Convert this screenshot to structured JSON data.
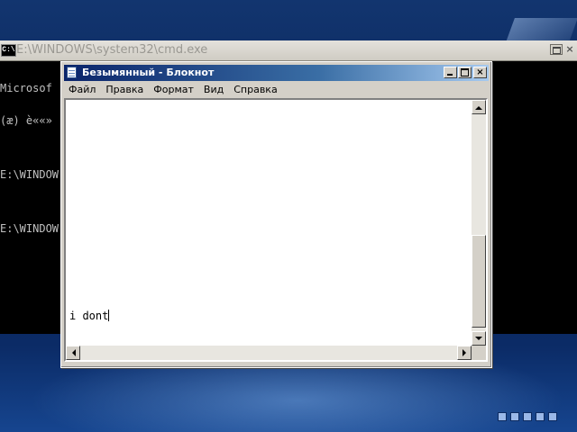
{
  "cmd_window": {
    "icon_label": "C:\\",
    "title": "E:\\WINDOWS\\system32\\cmd.exe",
    "close_label": "×",
    "lines": [
      "Microsof",
      "(æ) è««»",
      "",
      "E:\\WINDOW",
      "",
      "E:\\WINDOW"
    ]
  },
  "notepad": {
    "title": "Безымянный - Блокнот",
    "close_label": "×",
    "menu": [
      "Файл",
      "Правка",
      "Формат",
      "Вид",
      "Справка"
    ],
    "content": "i dont"
  },
  "colors": {
    "title_active_start": "#0a246a",
    "title_active_end": "#a6caf0",
    "window_face": "#d4d0c8",
    "console_bg": "#000000",
    "console_text": "#c0c0c0"
  }
}
